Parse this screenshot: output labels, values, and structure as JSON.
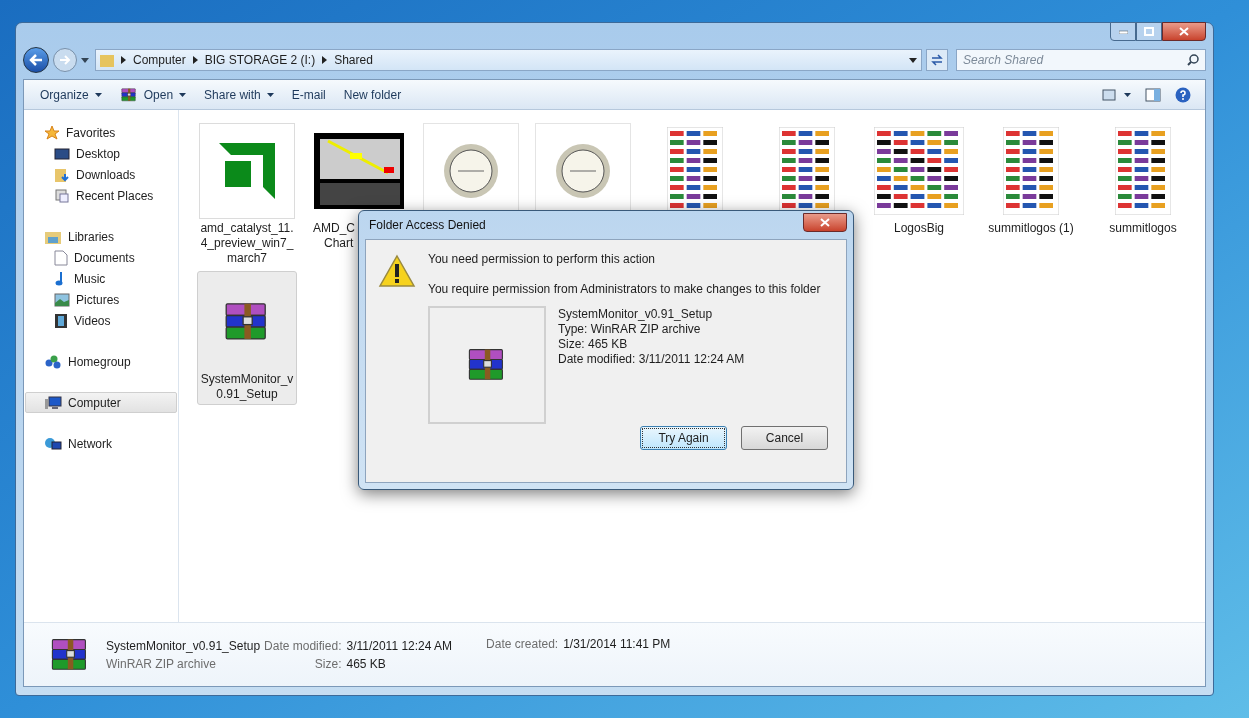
{
  "address_bar": {
    "breadcrumbs": [
      "Computer",
      "BIG STORAGE 2 (I:)",
      "Shared"
    ]
  },
  "search": {
    "placeholder": "Search Shared"
  },
  "toolbar": [
    {
      "label": "Organize",
      "kind": "plain",
      "has_menu": true
    },
    {
      "label": "Open",
      "kind": "winrar",
      "has_menu": true
    },
    {
      "label": "Share with",
      "kind": "plain",
      "has_menu": true
    },
    {
      "label": "E-mail",
      "kind": "plain",
      "has_menu": false
    },
    {
      "label": "New folder",
      "kind": "plain",
      "has_menu": false
    }
  ],
  "sidebar": [
    {
      "label": "Favorites",
      "kind": "star",
      "selected": false,
      "children": [
        {
          "label": "Desktop",
          "kind": "desktop",
          "selected": false
        },
        {
          "label": "Downloads",
          "kind": "downloads",
          "selected": false
        },
        {
          "label": "Recent Places",
          "kind": "recent",
          "selected": false
        }
      ]
    },
    {
      "label": "Libraries",
      "kind": "library",
      "selected": false,
      "children": [
        {
          "label": "Documents",
          "kind": "document",
          "selected": false
        },
        {
          "label": "Music",
          "kind": "music",
          "selected": false
        },
        {
          "label": "Pictures",
          "kind": "pictures",
          "selected": false
        },
        {
          "label": "Videos",
          "kind": "videos",
          "selected": false
        }
      ]
    },
    {
      "label": "Homegroup",
      "kind": "homegroup",
      "selected": false
    },
    {
      "label": "Computer",
      "kind": "computer",
      "selected": true
    },
    {
      "label": "Network",
      "kind": "network",
      "selected": false
    }
  ],
  "files": [
    {
      "name": "amd_catalyst_11.4_preview_win7_march7",
      "kind": "amd",
      "selected": false
    },
    {
      "name": "AMD_C",
      "name_2": "Chart",
      "kind": "chart",
      "selected": false
    },
    {
      "kind": "fusion",
      "selected": false
    },
    {
      "kind": "fusion",
      "selected": false
    },
    {
      "kind": "logos",
      "selected": false
    },
    {
      "kind": "logos",
      "selected": false
    },
    {
      "name": "LogosBig",
      "kind": "logos_wide",
      "selected": false
    },
    {
      "name": "summitlogos (1)",
      "kind": "logos",
      "selected": false
    },
    {
      "name": "summitlogos",
      "kind": "logos",
      "selected": false
    },
    {
      "name": "SystemMonitor_v0.91_Setup",
      "kind": "winrar",
      "selected": true
    }
  ],
  "dialog": {
    "title": "Folder Access Denied",
    "heading": "You need permission to perform this action",
    "message": "You require permission from Administrators to make changes to this folder",
    "file": {
      "name": "SystemMonitor_v0.91_Setup",
      "type": "Type: WinRAR ZIP archive",
      "size": "Size: 465 KB",
      "modified": "Date modified: 3/11/2011 12:24 AM"
    },
    "buttons": [
      {
        "label": "Try Again",
        "default": true
      },
      {
        "label": "Cancel",
        "default": false
      }
    ]
  },
  "status_bar": {
    "name": "SystemMonitor_v0.91_Setup",
    "type": "WinRAR ZIP archive",
    "modified_label": "Date modified:",
    "modified": "3/11/2011 12:24 AM",
    "size_label": "Size:",
    "size": "465 KB",
    "created_label": "Date created:",
    "created": "1/31/2014 11:41 PM"
  }
}
